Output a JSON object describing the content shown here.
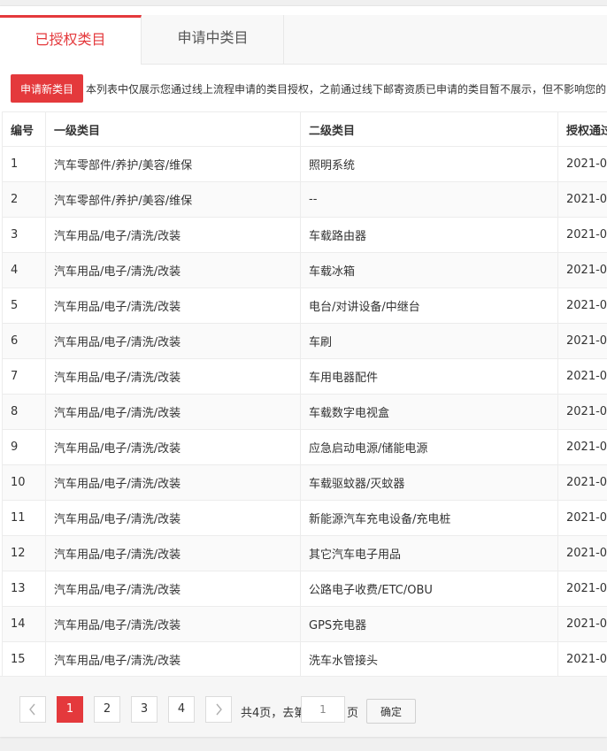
{
  "tabs": [
    {
      "label": "已授权类目",
      "active": true
    },
    {
      "label": "申请中类目",
      "active": false
    }
  ],
  "toolbar": {
    "apply_label": "申请新类目",
    "notice": "本列表中仅展示您通过线上流程申请的类目授权，之前通过线下邮寄资质已申请的类目暂不展示，但不影响您的"
  },
  "table": {
    "headers": [
      "编号",
      "一级类目",
      "二级类目",
      "授权通过"
    ],
    "rows": [
      {
        "no": "1",
        "cat1": "汽车零部件/养护/美容/维保",
        "cat2": "照明系统",
        "date": "2021-0"
      },
      {
        "no": "2",
        "cat1": "汽车零部件/养护/美容/维保",
        "cat2": "--",
        "date": "2021-0"
      },
      {
        "no": "3",
        "cat1": "汽车用品/电子/清洗/改装",
        "cat2": "车载路由器",
        "date": "2021-0"
      },
      {
        "no": "4",
        "cat1": "汽车用品/电子/清洗/改装",
        "cat2": "车载冰箱",
        "date": "2021-0"
      },
      {
        "no": "5",
        "cat1": "汽车用品/电子/清洗/改装",
        "cat2": "电台/对讲设备/中继台",
        "date": "2021-0"
      },
      {
        "no": "6",
        "cat1": "汽车用品/电子/清洗/改装",
        "cat2": "车刷",
        "date": "2021-0"
      },
      {
        "no": "7",
        "cat1": "汽车用品/电子/清洗/改装",
        "cat2": "车用电器配件",
        "date": "2021-0"
      },
      {
        "no": "8",
        "cat1": "汽车用品/电子/清洗/改装",
        "cat2": "车载数字电视盒",
        "date": "2021-0"
      },
      {
        "no": "9",
        "cat1": "汽车用品/电子/清洗/改装",
        "cat2": "应急启动电源/储能电源",
        "date": "2021-0"
      },
      {
        "no": "10",
        "cat1": "汽车用品/电子/清洗/改装",
        "cat2": "车载驱蚊器/灭蚊器",
        "date": "2021-0"
      },
      {
        "no": "11",
        "cat1": "汽车用品/电子/清洗/改装",
        "cat2": "新能源汽车充电设备/充电桩",
        "date": "2021-0"
      },
      {
        "no": "12",
        "cat1": "汽车用品/电子/清洗/改装",
        "cat2": "其它汽车电子用品",
        "date": "2021-0"
      },
      {
        "no": "13",
        "cat1": "汽车用品/电子/清洗/改装",
        "cat2": "公路电子收费/ETC/OBU",
        "date": "2021-0"
      },
      {
        "no": "14",
        "cat1": "汽车用品/电子/清洗/改装",
        "cat2": "GPS充电器",
        "date": "2021-0"
      },
      {
        "no": "15",
        "cat1": "汽车用品/电子/清洗/改装",
        "cat2": "洗车水管接头",
        "date": "2021-0"
      }
    ]
  },
  "pager": {
    "prev_icon": "chevron-left-icon",
    "next_icon": "chevron-right-icon",
    "pages": [
      "1",
      "2",
      "3",
      "4"
    ],
    "current": "1",
    "total_text": "共4页，去第",
    "input_value": "1",
    "page_suffix": "页",
    "confirm_label": "确定"
  },
  "colors": {
    "accent": "#e4393c"
  }
}
